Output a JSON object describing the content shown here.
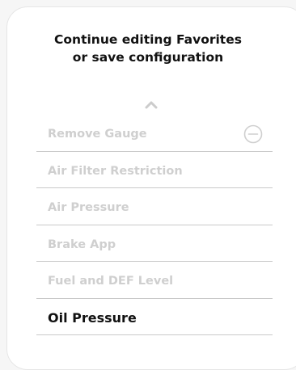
{
  "header": {
    "title_line1": "Continue editing Favorites",
    "title_line2": "or save configuration"
  },
  "list": {
    "items": [
      {
        "label": "Remove Gauge",
        "icon": "remove-circle-icon",
        "state": "dimmed"
      },
      {
        "label": "Air Filter Restriction",
        "state": "dimmed"
      },
      {
        "label": "Air Pressure",
        "state": "dimmed"
      },
      {
        "label": "Brake App",
        "state": "dimmed"
      },
      {
        "label": "Fuel and DEF Level",
        "state": "dimmed"
      },
      {
        "label": "Oil Pressure",
        "state": "selected"
      }
    ]
  },
  "colors": {
    "dimmed_text": "#cfcfcf",
    "selected_text": "#111111",
    "divider": "#c9c9c9",
    "chevron": "#cccccc"
  }
}
